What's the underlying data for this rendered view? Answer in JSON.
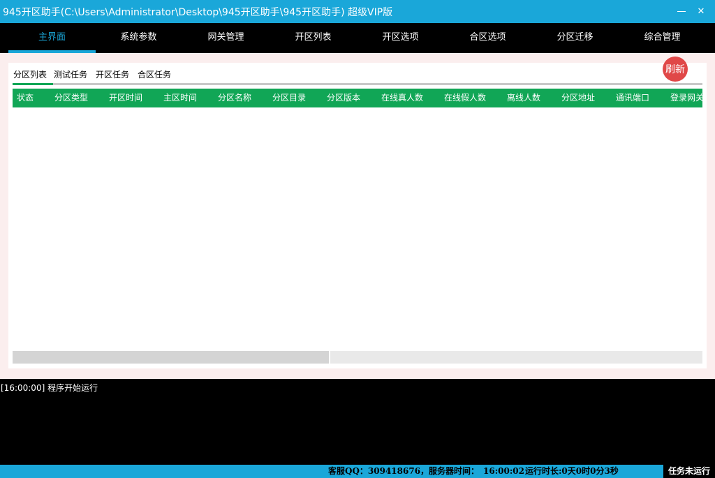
{
  "window": {
    "title": "945开区助手(C:\\Users\\Administrator\\Desktop\\945开区助手\\945开区助手) 超级VIP版",
    "close_glyph": "✕"
  },
  "nav": {
    "items": [
      "主界面",
      "系统参数",
      "网关管理",
      "开区列表",
      "开区选项",
      "合区选项",
      "分区迁移",
      "综合管理"
    ],
    "active_index": 0
  },
  "subtabs": {
    "items": [
      "分区列表",
      "测试任务",
      "开区任务",
      "合区任务"
    ],
    "active_index": 0
  },
  "refresh_label": "刷新",
  "table": {
    "columns": [
      "状态",
      "分区类型",
      "开区时间",
      "主区时间",
      "分区名称",
      "分区目录",
      "分区版本",
      "在线真人数",
      "在线假人数",
      "离线人数",
      "分区地址",
      "通讯端口",
      "登录网关"
    ],
    "rows": []
  },
  "log": {
    "lines": [
      "[16:00:00] 程序开始运行"
    ]
  },
  "status": {
    "service_qq": "客服QQ：309418676，服务器时间：",
    "server_time": "16:00:02",
    "runtime": "运行时长:0天0时0分3秒",
    "task_status": "任务未运行"
  },
  "colors": {
    "accent_blue": "#1aa7d9",
    "header_green": "#11a656",
    "refresh_red": "#e04848",
    "main_bg": "#fbeeee"
  }
}
